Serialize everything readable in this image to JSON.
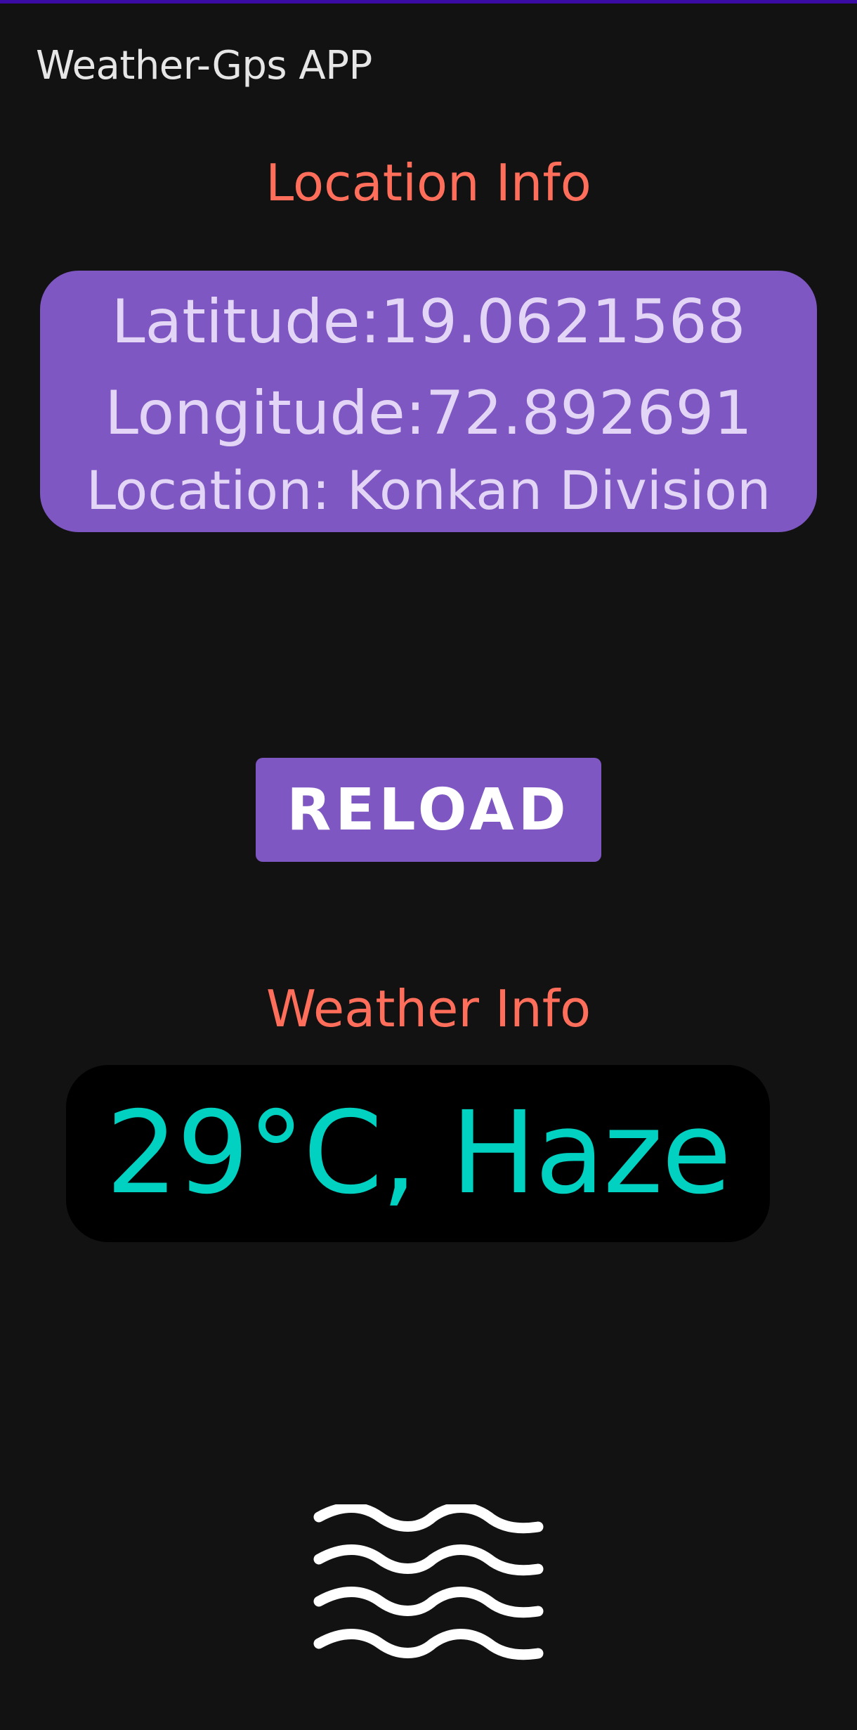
{
  "app": {
    "title": "Weather-Gps APP"
  },
  "location": {
    "heading": "Location Info",
    "latitude": "Latitude:19.0621568",
    "longitude": "Longitude:72.892691",
    "place": "Location: Konkan Division"
  },
  "controls": {
    "reload_label": "RELOAD"
  },
  "weather": {
    "heading": "Weather Info",
    "summary": "29°C, Haze",
    "icon": "haze-icon"
  },
  "colors": {
    "background": "#121212",
    "accent": "#7e57c2",
    "heading": "#ff6e5a",
    "weather_text": "#00d1c1",
    "status_strip": "#3a0ca3"
  }
}
